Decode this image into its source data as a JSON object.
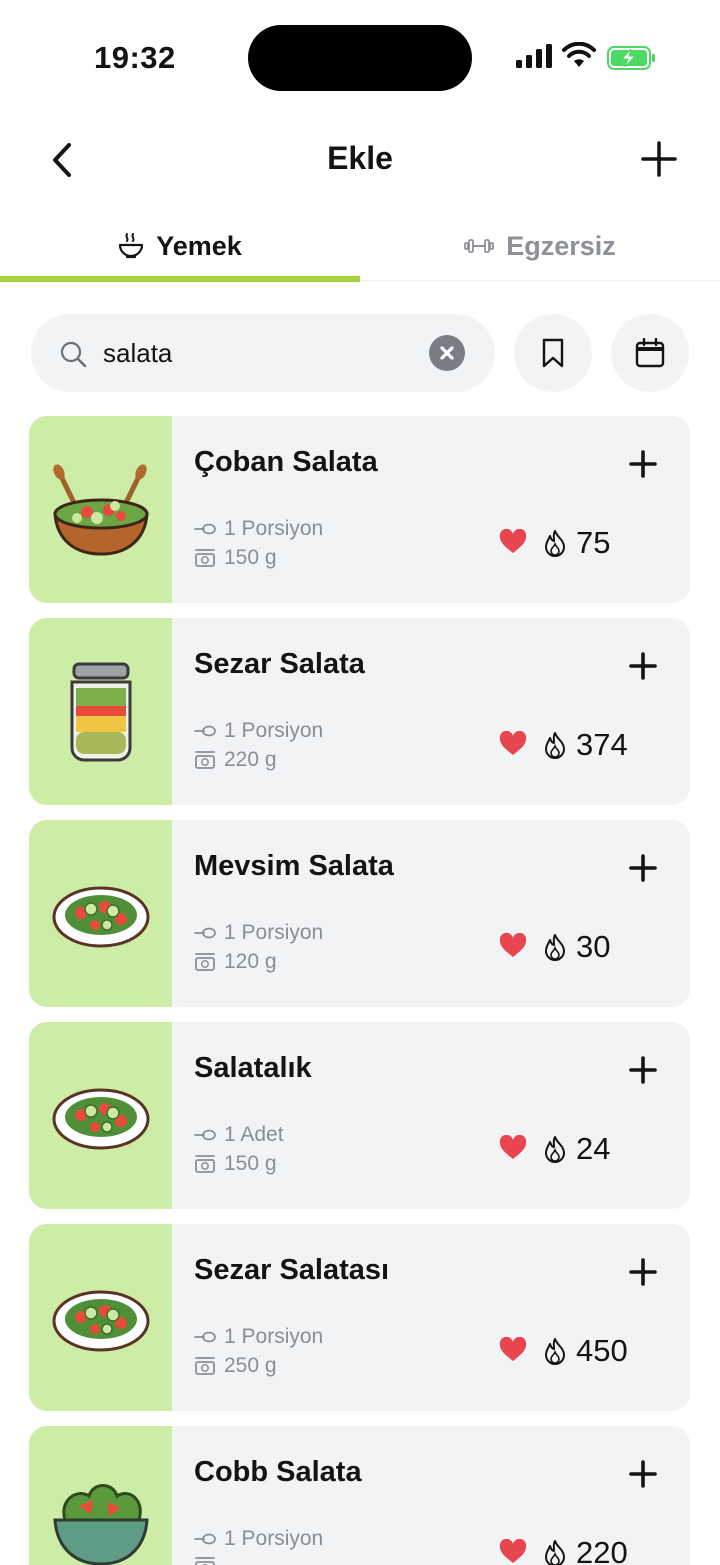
{
  "status_bar": {
    "time": "19:32"
  },
  "header": {
    "title": "Ekle"
  },
  "tabs": [
    {
      "label": "Yemek",
      "icon": "bowl-icon",
      "active": true
    },
    {
      "label": "Egzersiz",
      "icon": "dumbbell-icon",
      "active": false
    }
  ],
  "search": {
    "value": "salata",
    "placeholder": ""
  },
  "colors": {
    "accent": "#a9d341",
    "thumb_bg": "#cdeca6",
    "card_bg": "#f1f3f5",
    "heart": "#e8464f"
  },
  "foods": [
    {
      "name": "Çoban Salata",
      "portion": "1 Porsiyon",
      "weight": "150 g",
      "calories": "75",
      "image": "wooden-salad-bowl"
    },
    {
      "name": "Sezar Salata",
      "portion": "1 Porsiyon",
      "weight": "220 g",
      "calories": "374",
      "image": "salad-jar"
    },
    {
      "name": "Mevsim Salata",
      "portion": "1 Porsiyon",
      "weight": "120 g",
      "calories": "30",
      "image": "salad-plate"
    },
    {
      "name": "Salatalık",
      "portion": "1 Adet",
      "weight": "150 g",
      "calories": "24",
      "image": "salad-plate"
    },
    {
      "name": "Sezar Salatası",
      "portion": "1 Porsiyon",
      "weight": "250 g",
      "calories": "450",
      "image": "salad-plate"
    },
    {
      "name": "Cobb Salata",
      "portion": "1 Porsiyon",
      "weight": "",
      "calories": "220",
      "image": "green-salad-bowl"
    }
  ]
}
